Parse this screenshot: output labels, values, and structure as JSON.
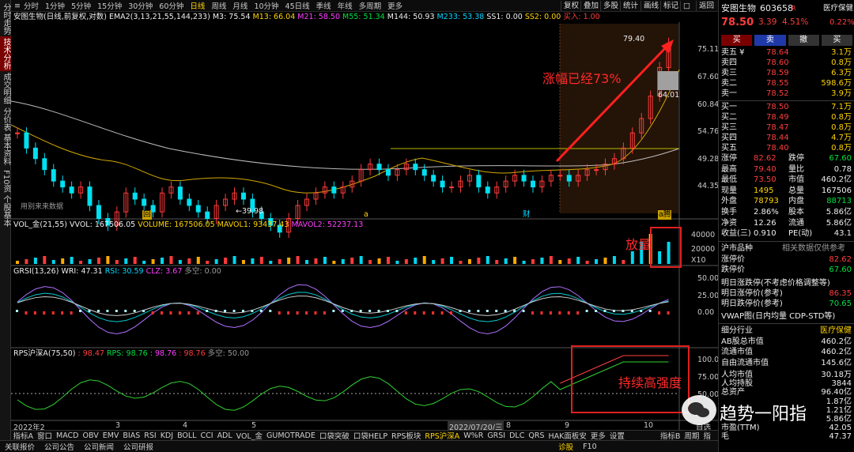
{
  "left_tabs": [
    "分时走势",
    "技术分析",
    "成交明细",
    "分价表",
    "基本资料",
    "F10资讯",
    "个股基本"
  ],
  "top_periods": [
    "分时",
    "1分钟",
    "5分钟",
    "15分钟",
    "30分钟",
    "60分钟",
    "日线",
    "周线",
    "月线",
    "10分钟",
    "45日线",
    "季线",
    "年线",
    "多周期",
    "更多"
  ],
  "top_buttons": [
    "复权",
    "叠加",
    "多股",
    "统计",
    "画线",
    "标记",
    "□",
    "返回"
  ],
  "main_info": {
    "title": "安图生物(日线,前复权,对数)",
    "ema": "EMA2(3,13,21,55,144,233)",
    "m3": "M3: 75.54",
    "m13": "M13: 66.04",
    "m21": "M21: 58.50",
    "m55": "M55: 51.34",
    "m144": "M144: 50.93",
    "m233": "M233: 53.38",
    "ss1": "SS1: 0.00",
    "ss2": "SS2: 0.00",
    "buyin": "买入: 1.00"
  },
  "price_axis": [
    "75.11",
    "67.60",
    "60.84",
    "54.76",
    "49.28",
    "44.35"
  ],
  "price_tags": {
    "high": "79.40",
    "low_mark": "64.01",
    "low": "←39.98",
    "watermark": "用别来来数据"
  },
  "annotations": {
    "rise": "涨幅已经73%",
    "volume": "放量",
    "rps": "持续高强度"
  },
  "markers": [
    "回",
    "a",
    "财",
    "a腾"
  ],
  "vol_info": {
    "title": "VOL_金(21,55)",
    "vvol": "VVOL: 167506.05",
    "volume": "VOLUME: 167506.05",
    "mavol1": "MAVOL1: 93437.43",
    "mavol2": "MAVOL2: 52237.13"
  },
  "vol_axis": [
    "40000",
    "20000",
    "X10"
  ],
  "grsi_info": {
    "title": "GRSI(13,26)",
    "wri": "WRI: 47.31",
    "rsi": "RSI: 30.59",
    "clz": "CLZ: 3.67",
    "dk": "多空: 0.00"
  },
  "grsi_axis": [
    "50.00",
    "25.00",
    "0.00"
  ],
  "rps_info": {
    "title": "RPS沪深A(75,50)",
    "v1": ": 98.47",
    "rps": "RPS: 98.76",
    "v3": ": 98.76",
    "v4": ": 98.76",
    "dk": "多空: 50.00"
  },
  "rps_axis": [
    "100.0",
    "75.00",
    "50.00"
  ],
  "x_axis": [
    "2022年2",
    "3",
    "4",
    "5",
    "2022/07/20/三",
    "8",
    "9",
    "10",
    "10",
    "自选"
  ],
  "toolbar": [
    "指标A",
    "窗口",
    "MACD",
    "OBV",
    "EMV",
    "BIAS",
    "RSI",
    "KDJ",
    "BOLL",
    "CCI",
    "ADL",
    "VOL_金",
    "GUMOTRADE",
    "口袋突破",
    "口袋HELP",
    "RPS板块",
    "RPS沪深A",
    "W%R",
    "GRSI",
    "DLC",
    "QRS",
    "HAK面板安",
    "更多",
    "设置",
    "指标B",
    "周期",
    "指"
  ],
  "status": [
    "关联报价",
    "公司公告",
    "公司新闻",
    "公司研报"
  ],
  "status_right": [
    "诊股",
    "F10"
  ],
  "quote": {
    "name": "安图生物",
    "code": "603658",
    "tag": "R",
    "sector": "医疗保健",
    "price": "78.50",
    "change": "3.39",
    "pct": "4.51%",
    "weibi": "0.22%",
    "actions": [
      "买",
      "卖",
      "撤",
      "买"
    ],
    "sell": [
      {
        "l": "卖五 ¥",
        "p": "78.64",
        "v": "3.1万"
      },
      {
        "l": "卖四",
        "p": "78.60",
        "v": "0.8万"
      },
      {
        "l": "卖三",
        "p": "78.59",
        "v": "6.3万"
      },
      {
        "l": "卖二",
        "p": "78.55",
        "v": "598.6万"
      },
      {
        "l": "卖一",
        "p": "78.52",
        "v": "3.9万"
      }
    ],
    "buy": [
      {
        "l": "买一",
        "p": "78.50",
        "v": "7.1万"
      },
      {
        "l": "买二",
        "p": "78.49",
        "v": "0.8万"
      },
      {
        "l": "买三",
        "p": "78.47",
        "v": "0.8万"
      },
      {
        "l": "买四",
        "p": "78.44",
        "v": "4.7万"
      },
      {
        "l": "买五",
        "p": "78.40",
        "v": "0.8万"
      }
    ],
    "stats": [
      {
        "a": "涨停",
        "av": "82.62",
        "b": "跌停",
        "bv": "67.60"
      },
      {
        "a": "最高",
        "av": "79.40",
        "b": "量比",
        "bv": "0.78"
      },
      {
        "a": "最低",
        "av": "73.50",
        "b": "市值",
        "bv": "460.2亿"
      },
      {
        "a": "现量",
        "av": "1495",
        "b": "总量",
        "bv": "167506"
      },
      {
        "a": "外盘",
        "av": "78793",
        "b": "内盘",
        "bv": "88713"
      },
      {
        "a": "换手",
        "av": "2.86%",
        "b": "股本",
        "bv": "5.86亿"
      },
      {
        "a": "净资",
        "av": "12.26",
        "b": "流通",
        "bv": "5.86亿"
      },
      {
        "a": "收益(三)",
        "av": "0.910",
        "b": "PE(动)",
        "bv": "43.1"
      }
    ],
    "market_title": "沪市品种",
    "market_note": "相关数据仅供参考",
    "limits": [
      {
        "l": "涨停价",
        "v": "82.62"
      },
      {
        "l": "跌停价",
        "v": "67.60"
      }
    ],
    "tomorrow": [
      {
        "l": "明日涨跌停(不考虑价格调整等)",
        "v": ""
      },
      {
        "l": "明日涨停价(参考)",
        "v": "86.35"
      },
      {
        "l": "明日跌停价(参考)",
        "v": "70.65"
      }
    ],
    "vwap": "VWAP图(日内均量 CDP-STD等)",
    "industry": [
      {
        "l": "细分行业",
        "v": "医疗保健"
      },
      {
        "l": "AB股总市值",
        "v": "460.2亿"
      },
      {
        "l": "流通市值",
        "v": "460.2亿"
      },
      {
        "l": "自由流通市值",
        "v": "145.6亿"
      }
    ],
    "per": [
      {
        "l": "人均市值",
        "v": "30.18万"
      },
      {
        "l": "人均持股",
        "v": "3844"
      },
      {
        "l": "总资产",
        "v": "96.40亿"
      },
      {
        "l": "",
        "v": "1.87亿"
      },
      {
        "l": "",
        "v": "1.21亿"
      },
      {
        "l": "",
        "v": "5.86亿"
      },
      {
        "l": "市盈(TTM)",
        "v": "42.05"
      },
      {
        "l": "毛",
        "v": "47.37"
      }
    ]
  },
  "watermark_text": "趋势一阳指",
  "chart_data": [
    {
      "type": "candlestick",
      "title": "安图生物(日线,前复权,对数)",
      "ylim": [
        44,
        80
      ],
      "x": [
        "2022-02",
        "2022-03",
        "2022-04",
        "2022-05",
        "2022-06",
        "2022-07",
        "2022-08",
        "2022-09",
        "2022-10"
      ],
      "close": [
        57,
        54,
        52,
        50,
        48,
        47,
        46,
        47,
        44,
        42,
        41,
        43,
        46,
        45,
        44,
        43,
        46,
        47,
        45,
        44,
        43,
        42,
        44,
        45,
        46,
        45,
        43,
        42,
        41,
        40,
        42,
        44,
        45,
        46,
        47,
        46,
        47,
        48,
        50,
        51,
        50,
        49,
        50,
        51,
        50,
        49,
        48,
        47,
        47,
        48,
        49,
        47,
        46,
        47,
        48,
        49,
        48,
        47,
        48,
        49,
        49,
        48,
        49,
        50,
        50,
        51,
        52,
        54,
        57,
        60,
        65,
        72,
        78.5
      ],
      "annotations": [
        "涨幅已经73%"
      ]
    },
    {
      "type": "bar",
      "title": "VOL_金(21,55)",
      "ylim": [
        0,
        40000
      ]
    },
    {
      "type": "line",
      "title": "GRSI(13,26)",
      "ylim": [
        0,
        50
      ]
    },
    {
      "type": "line",
      "title": "RPS沪深A(75,50)",
      "ylim": [
        40,
        100
      ]
    }
  ]
}
